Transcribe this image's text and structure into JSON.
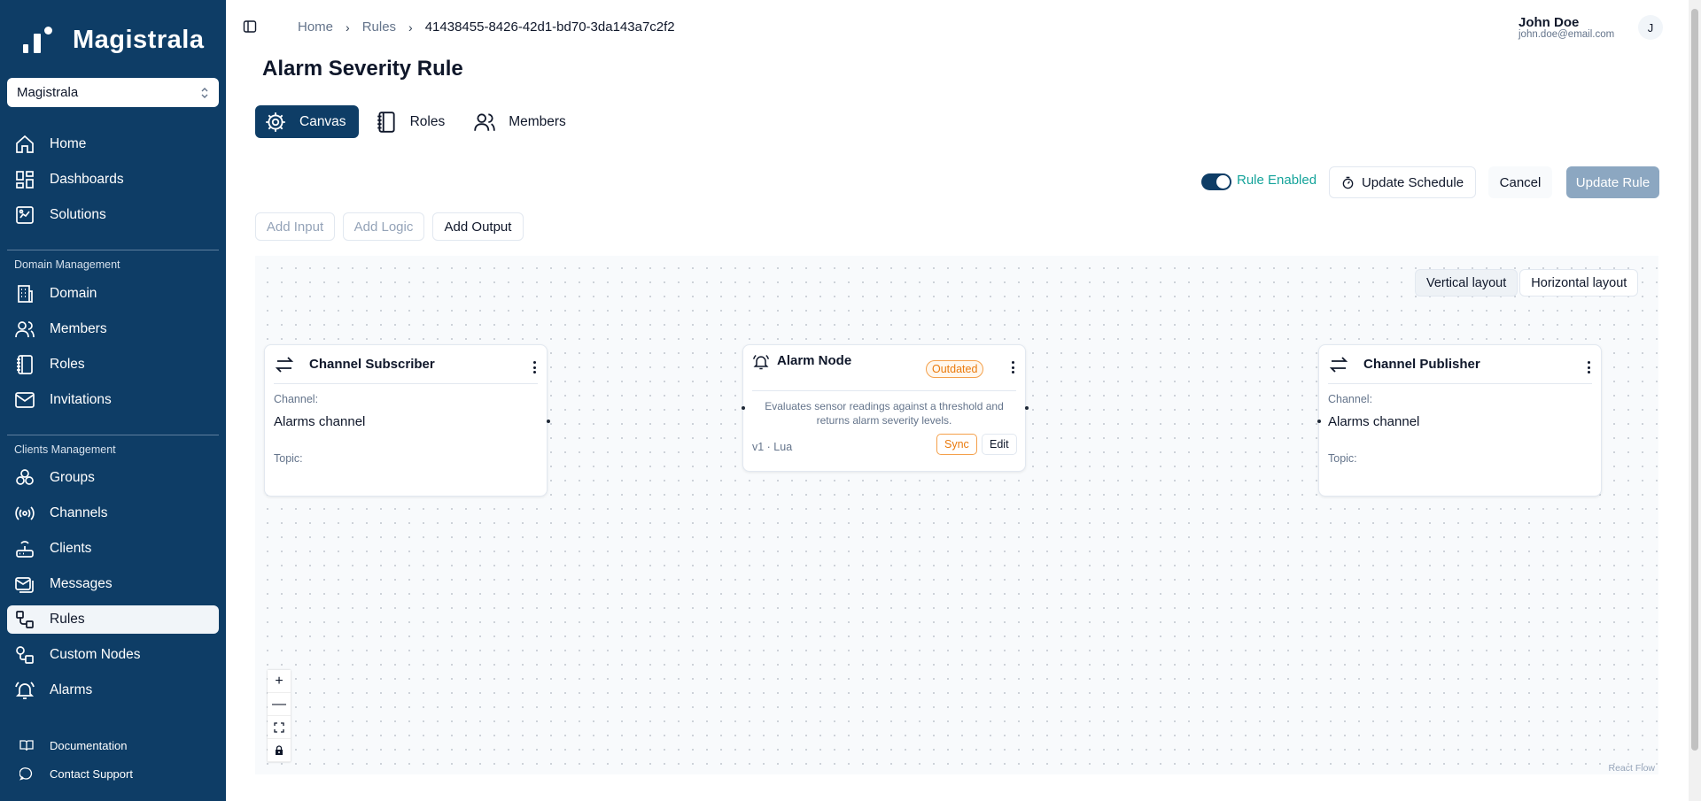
{
  "brand": {
    "name": "Magistrala"
  },
  "domain_select": {
    "value": "Magistrala"
  },
  "sidebar": {
    "top_items": [
      {
        "label": "Home",
        "icon": "home-icon"
      },
      {
        "label": "Dashboards",
        "icon": "dashboard-icon"
      },
      {
        "label": "Solutions",
        "icon": "solutions-icon"
      }
    ],
    "domain_section": "Domain Management",
    "domain_items": [
      {
        "label": "Domain",
        "icon": "building-icon"
      },
      {
        "label": "Members",
        "icon": "users-icon"
      },
      {
        "label": "Roles",
        "icon": "notebook-icon"
      },
      {
        "label": "Invitations",
        "icon": "mail-icon"
      }
    ],
    "clients_section": "Clients Management",
    "clients_items": [
      {
        "label": "Groups",
        "icon": "groups-icon"
      },
      {
        "label": "Channels",
        "icon": "radio-icon"
      },
      {
        "label": "Clients",
        "icon": "router-icon"
      },
      {
        "label": "Messages",
        "icon": "messages-icon"
      },
      {
        "label": "Rules",
        "icon": "workflow-icon",
        "active": true
      },
      {
        "label": "Custom Nodes",
        "icon": "custom-nodes-icon"
      },
      {
        "label": "Alarms",
        "icon": "bell-icon"
      }
    ],
    "footer_items": [
      {
        "label": "Documentation",
        "icon": "book-icon"
      },
      {
        "label": "Contact Support",
        "icon": "chat-icon"
      }
    ]
  },
  "breadcrumb": {
    "home": "Home",
    "rules": "Rules",
    "current": "41438455-8426-42d1-bd70-3da143a7c2f2"
  },
  "user": {
    "name": "John Doe",
    "email": "john.doe@email.com",
    "initial": "J"
  },
  "page": {
    "title": "Alarm Severity Rule"
  },
  "tabs": [
    {
      "label": "Canvas",
      "icon": "gear-icon",
      "active": true
    },
    {
      "label": "Roles",
      "icon": "notebook-icon"
    },
    {
      "label": "Members",
      "icon": "users-icon"
    }
  ],
  "actions": {
    "toggle_label": "Rule Enabled",
    "rule_enabled": true,
    "update_schedule": "Update Schedule",
    "cancel": "Cancel",
    "update_rule": "Update Rule"
  },
  "add_buttons": {
    "input": "Add Input",
    "logic": "Add Logic",
    "output": "Add Output"
  },
  "layout": {
    "vertical": "Vertical layout",
    "horizontal": "Horizontal layout"
  },
  "nodes": {
    "subscriber": {
      "title": "Channel Subscriber",
      "channel_label": "Channel:",
      "channel_value": "Alarms channel",
      "topic_label": "Topic:"
    },
    "alarm": {
      "title": "Alarm Node",
      "badge": "Outdated",
      "description": "Evaluates sensor readings against a threshold and returns alarm severity levels.",
      "version": "v1 · Lua",
      "sync": "Sync",
      "edit": "Edit"
    },
    "publisher": {
      "title": "Channel Publisher",
      "channel_label": "Channel:",
      "channel_value": "Alarms channel",
      "topic_label": "Topic:"
    }
  },
  "controls": {
    "zoom_in": "+",
    "zoom_out": "—"
  },
  "attribution": "React Flow",
  "colors": {
    "sidebar": "#0e3d66",
    "primary": "#0e3d66",
    "accent_teal": "#14a39a",
    "warning": "#ea7a0c"
  }
}
